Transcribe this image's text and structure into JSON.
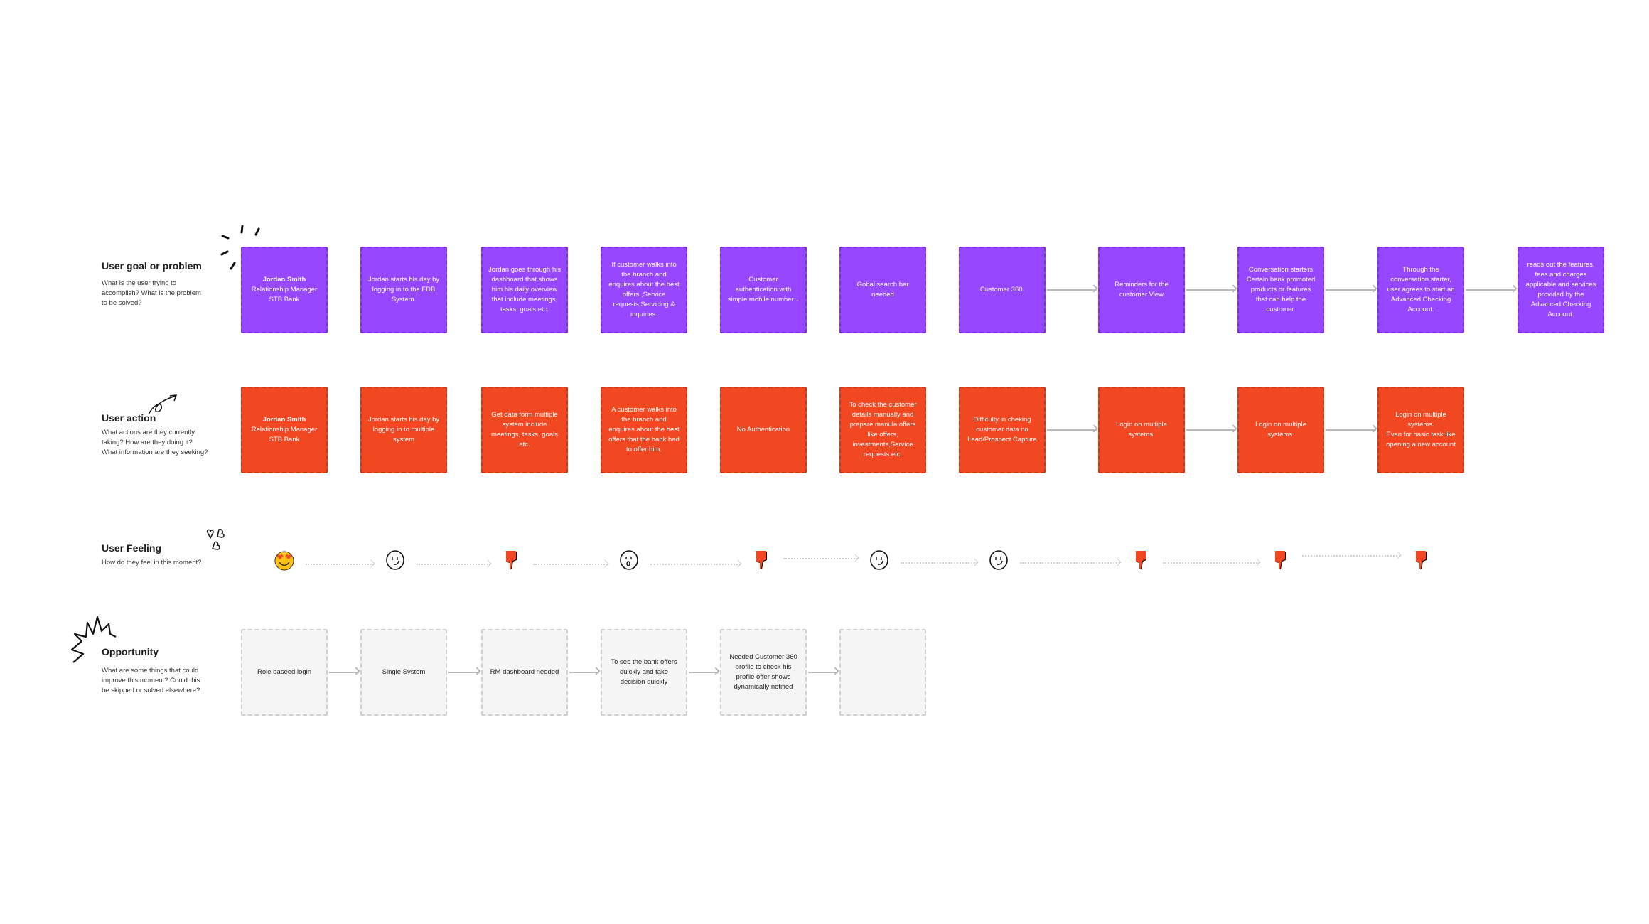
{
  "colors": {
    "goal": "#9747FF",
    "action": "#F24822",
    "opportunity": "#F5F5F5",
    "thumb": "#F24822"
  },
  "rows": {
    "goal": {
      "title": "User goal or problem",
      "desc": "What is the user trying to accomplish? What is the problem to be solved?"
    },
    "action": {
      "title": "User action",
      "desc": "What actions are they currently taking? How are they doing it? What information are they seeking?"
    },
    "feeling": {
      "title": "User Feeling",
      "desc": "How do they feel in this moment?"
    },
    "opportunity": {
      "title": "Opportunity",
      "desc": "What are some things that could improve this moment? Could this be skipped or solved elsewhere?"
    }
  },
  "goal_cards": [
    {
      "title": "Jordan Smith",
      "text": "Relationship Manager\nSTB Bank"
    },
    {
      "text": "Jordan starts his day by logging in to the FDB System."
    },
    {
      "text": "Jordan goes through his dashboard that shows him his daily overview that include meetings, tasks, goals etc."
    },
    {
      "text": "If customer walks into the branch and enquires about the best offers ,Service requests,Servicing & inquiries."
    },
    {
      "text": "Customer authentication with simple  mobile number..."
    },
    {
      "text": "Gobal search bar needed"
    },
    {
      "text": "Customer 360."
    },
    {
      "text": "Reminders for the customer View"
    },
    {
      "text": "Conversation starters Certain bank promoted products or features that can help the customer."
    },
    {
      "text": "Through the conversation starter, user agrees to start an Advanced Checking Account."
    },
    {
      "text": "reads out the features, fees and charges applicable and services provided by the Advanced Checking Account."
    }
  ],
  "action_cards": [
    {
      "title": "Jordan Smith",
      "text": "Relationship Manager\nSTB Bank"
    },
    {
      "text": "Jordan starts his day by logging in to multiple system"
    },
    {
      "text": "Get data form multiple system include meetings, tasks, goals etc."
    },
    {
      "text": "A customer walks into the branch and enquires about the best offers that the bank had to offer him."
    },
    {
      "text": "No Authentication"
    },
    {
      "text": "To check the customer details manually and prepare manula offers like offers, investments,Service requests etc."
    },
    {
      "text": "Difficulty in cheking customer data no Lead/Prospect Capture"
    },
    {
      "text": "Login on multiple systems."
    },
    {
      "text": "Login on multiple systems."
    },
    {
      "text": "Login on multiple systems.\nEven for basic task like opening a new account"
    }
  ],
  "feelings": [
    "heart-eyes",
    "smile",
    "thumbs-down",
    "surprised",
    "thumbs-down",
    "smile",
    "smile",
    "thumbs-down",
    "thumbs-down",
    "thumbs-down"
  ],
  "opportunity_cards": [
    {
      "text": "Role baseed login"
    },
    {
      "text": "Single System"
    },
    {
      "text": "RM dashboard needed"
    },
    {
      "text": "To see the bank offers quickly and take decision quickly"
    },
    {
      "text": "Needed Customer 360 profile to check his profile offer shows dynamically notified"
    },
    {
      "text": ""
    }
  ]
}
